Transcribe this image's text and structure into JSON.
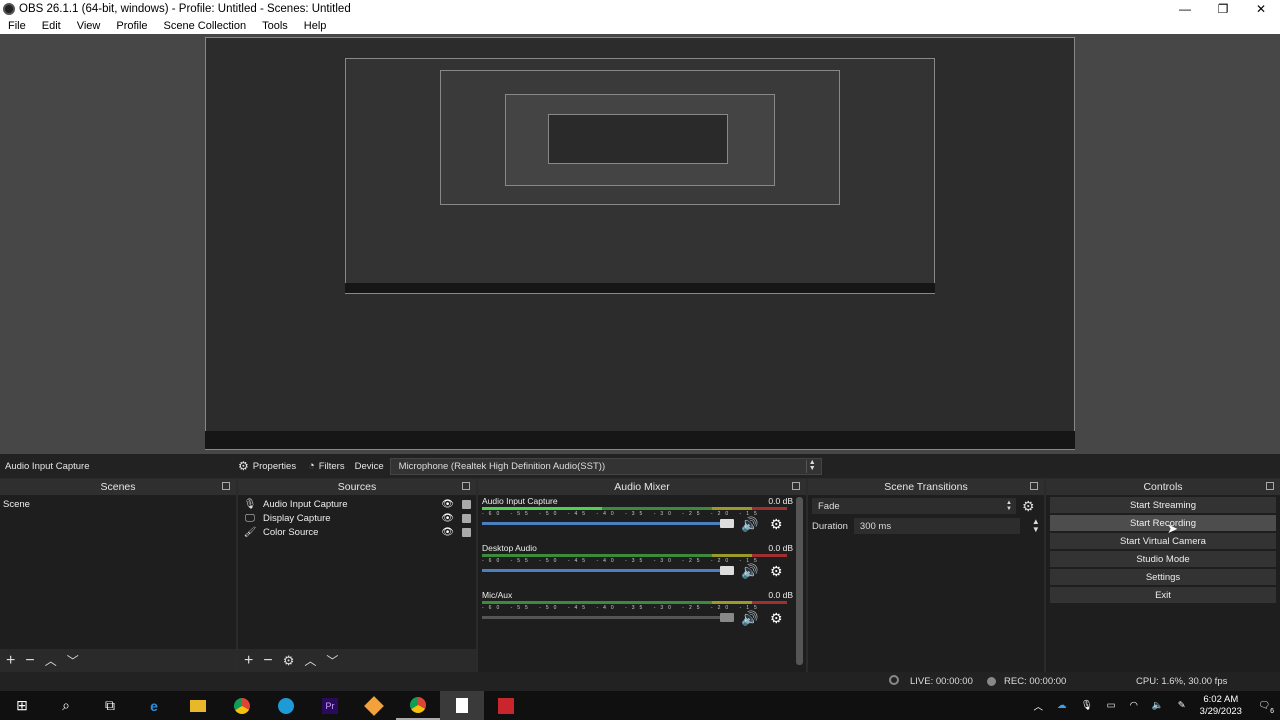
{
  "window": {
    "title": "OBS 26.1.1 (64-bit, windows) - Profile: Untitled - Scenes: Untitled",
    "min": "—",
    "max": "❐",
    "close": "✕"
  },
  "menu": [
    "File",
    "Edit",
    "View",
    "Profile",
    "Scene Collection",
    "Tools",
    "Help"
  ],
  "source_toolbar": {
    "selected_source": "Audio Input Capture",
    "properties": "Properties",
    "filters": "Filters",
    "device_label": "Device",
    "device_value": "Microphone (Realtek High Definition Audio(SST))"
  },
  "scenes": {
    "title": "Scenes",
    "items": [
      "Scene"
    ]
  },
  "sources": {
    "title": "Sources",
    "items": [
      {
        "icon": "microphone-icon",
        "glyph": "🎙",
        "label": "Audio Input Capture"
      },
      {
        "icon": "monitor-icon",
        "glyph": "🖵",
        "label": "Display Capture"
      },
      {
        "icon": "brush-icon",
        "glyph": "🖌",
        "label": "Color Source"
      }
    ]
  },
  "mixer": {
    "title": "Audio Mixer",
    "ticks": "-60 -55 -50 -45 -40 -35 -30 -25 -20 -15 -10 -5 0",
    "channels": [
      {
        "name": "Audio Input Capture",
        "db": "0.0 dB",
        "level": 0.4
      },
      {
        "name": "Desktop Audio",
        "db": "0.0 dB",
        "level": 0
      },
      {
        "name": "Mic/Aux",
        "db": "0.0 dB",
        "level": 0
      }
    ]
  },
  "transitions": {
    "title": "Scene Transitions",
    "type": "Fade",
    "duration_label": "Duration",
    "duration_value": "300 ms"
  },
  "controls": {
    "title": "Controls",
    "buttons": [
      "Start Streaming",
      "Start Recording",
      "Start Virtual Camera",
      "Studio Mode",
      "Settings",
      "Exit"
    ]
  },
  "status": {
    "live": "LIVE: 00:00:00",
    "rec": "REC: 00:00:00",
    "cpu": "CPU: 1.6%, 30.00 fps"
  },
  "taskbar": {
    "time": "6:02 AM",
    "date": "3/29/2023",
    "notif_count": "6"
  },
  "colors": {
    "accent": "#4a7fc1",
    "meter_green": "#3c8a3c",
    "meter_yellow": "#9a9a2a",
    "meter_red": "#a03030"
  }
}
